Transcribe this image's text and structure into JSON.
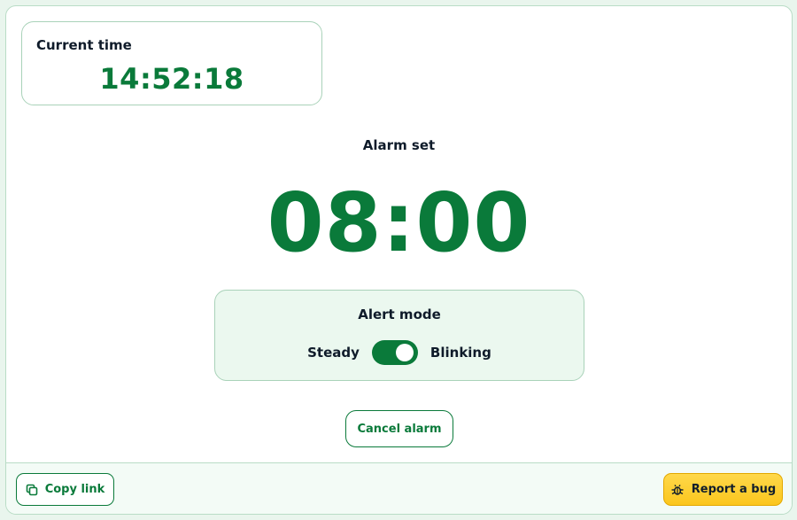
{
  "current_time": {
    "label": "Current time",
    "value": "14:52:18"
  },
  "alarm": {
    "label": "Alarm set",
    "time": "08:00"
  },
  "alert_mode": {
    "title": "Alert mode",
    "left_option": "Steady",
    "right_option": "Blinking",
    "selected": "Blinking"
  },
  "cancel_button": {
    "label": "Cancel alarm"
  },
  "footer": {
    "copy_link_label": "Copy link",
    "copy_link_icon": "copy-icon",
    "report_bug_label": "Report a bug",
    "report_bug_icon": "bug-icon"
  },
  "colors": {
    "accent": "#0a7a3a",
    "page_bg": "#e9f5ed",
    "mode_card_bg": "#ebf8ef",
    "bug_button": "#fbc61d"
  }
}
